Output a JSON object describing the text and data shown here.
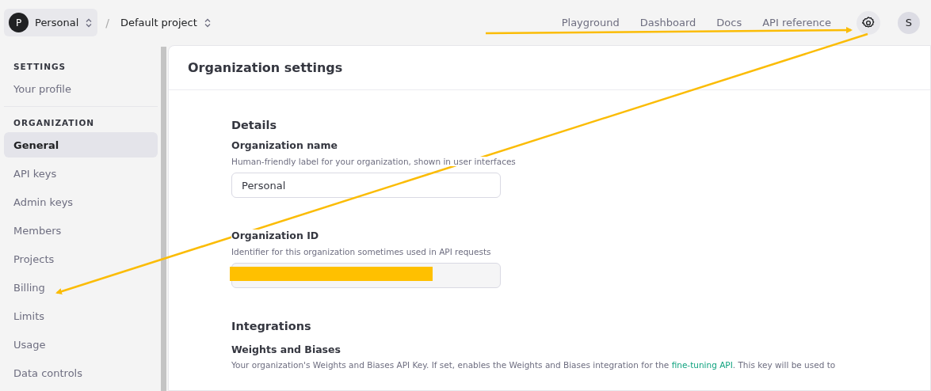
{
  "topbar": {
    "org": {
      "initial": "P",
      "name": "Personal"
    },
    "separator": "/",
    "project": "Default project",
    "links": [
      "Playground",
      "Dashboard",
      "Docs",
      "API reference"
    ],
    "avatar": "S"
  },
  "sidebar": {
    "sections": [
      {
        "title": "SETTINGS",
        "items": [
          {
            "label": "Your profile",
            "selected": false
          }
        ]
      },
      {
        "title": "ORGANIZATION",
        "items": [
          {
            "label": "General",
            "selected": true
          },
          {
            "label": "API keys",
            "selected": false
          },
          {
            "label": "Admin keys",
            "selected": false
          },
          {
            "label": "Members",
            "selected": false
          },
          {
            "label": "Projects",
            "selected": false
          },
          {
            "label": "Billing",
            "selected": false
          },
          {
            "label": "Limits",
            "selected": false
          },
          {
            "label": "Usage",
            "selected": false
          },
          {
            "label": "Data controls",
            "selected": false
          }
        ]
      }
    ]
  },
  "page": {
    "title": "Organization settings",
    "details": {
      "heading": "Details",
      "fields": [
        {
          "label": "Organization name",
          "hint": "Human-friendly label for your organization, shown in user interfaces",
          "value": "Personal",
          "disabled": false
        },
        {
          "label": "Organization ID",
          "hint": "Identifier for this organization sometimes used in API requests",
          "disabled": true,
          "redacted": true
        }
      ]
    },
    "integrations": {
      "heading": "Integrations",
      "subheading": "Weights and Biases",
      "text_before": "Your organization's Weights and Biases API Key. If set, enables the Weights and Biases integration for the",
      "link": "fine-tuning API",
      "text_after": ". This key will be used to"
    }
  }
}
